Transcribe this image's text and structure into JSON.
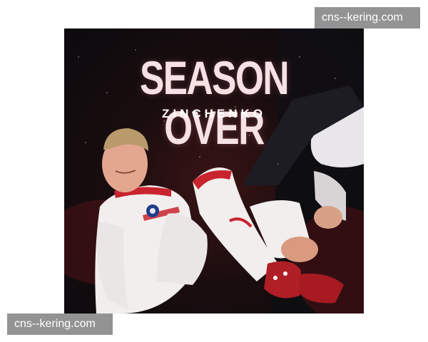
{
  "poster": {
    "headline": "SEASON OVER",
    "subline": "ZINCHENKO",
    "colors": {
      "background": "#0b0a0d",
      "headline_text": "#f6e2e4",
      "kit_red": "#c8242e",
      "kit_white": "#f2eeee"
    }
  },
  "watermarks": {
    "top": "cns--kering.com",
    "bottom": "cns--kering.com"
  }
}
